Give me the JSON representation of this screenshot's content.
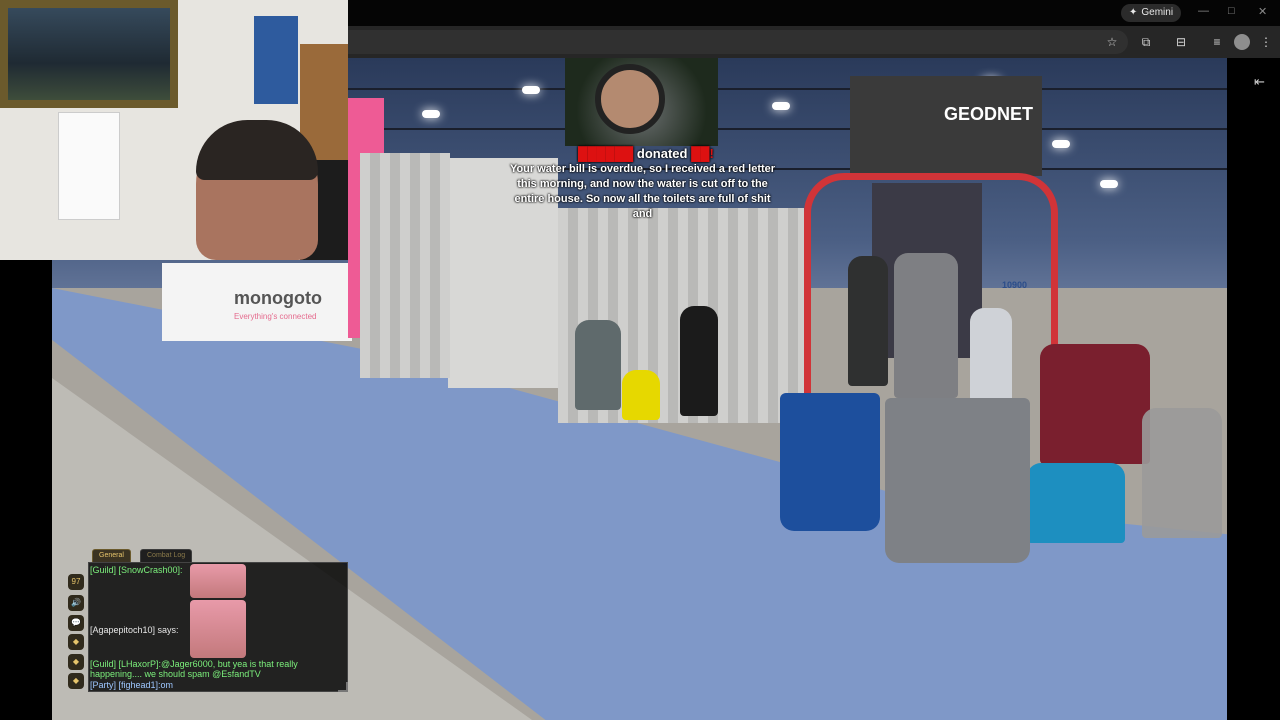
{
  "browser": {
    "gemini_label": "Gemini",
    "gemini_glyph": "✦",
    "window_controls": [
      "—",
      "□",
      "✕"
    ],
    "toolbar_icons": [
      "star-icon",
      "extensions-icon",
      "tab-search-icon",
      "media-icon",
      "profile-icon",
      "menu-icon"
    ],
    "toolbar_glyphs": [
      "☆",
      "⧉",
      "⊟",
      "≡",
      "",
      "⋮"
    ],
    "side_panel_glyph": "⇤"
  },
  "scene": {
    "booth_signs": {
      "monogoto": "monogoto",
      "monogoto_tagline": "Everything's connected",
      "geodnet": "GEODNET",
      "booth_number": "10900"
    }
  },
  "alert": {
    "donor": "donated",
    "amount_hidden": "",
    "message": "Your water bill is overdue, so I received a red letter this morning, and now the water is cut off to the entire house. So now all the toilets are full of shit and"
  },
  "chat": {
    "tabs": [
      "General",
      "Combat Log"
    ],
    "side_icons": [
      "97",
      "🔊",
      "💬",
      "◆",
      "◆",
      "◆"
    ],
    "lines": [
      {
        "text": "[Guild] [SnowCrash00]:",
        "style": "green"
      },
      {
        "text": "[Agapepitoch10] says:",
        "style": "white"
      },
      {
        "text": "[Guild] [LHaxorP]:@Jager6000, but yea is that really",
        "style": "green"
      },
      {
        "text": "happening.... we should spam @EsfandTV",
        "style": "green"
      },
      {
        "text": "[Party] [fighead1]:om",
        "style": "party"
      }
    ]
  }
}
